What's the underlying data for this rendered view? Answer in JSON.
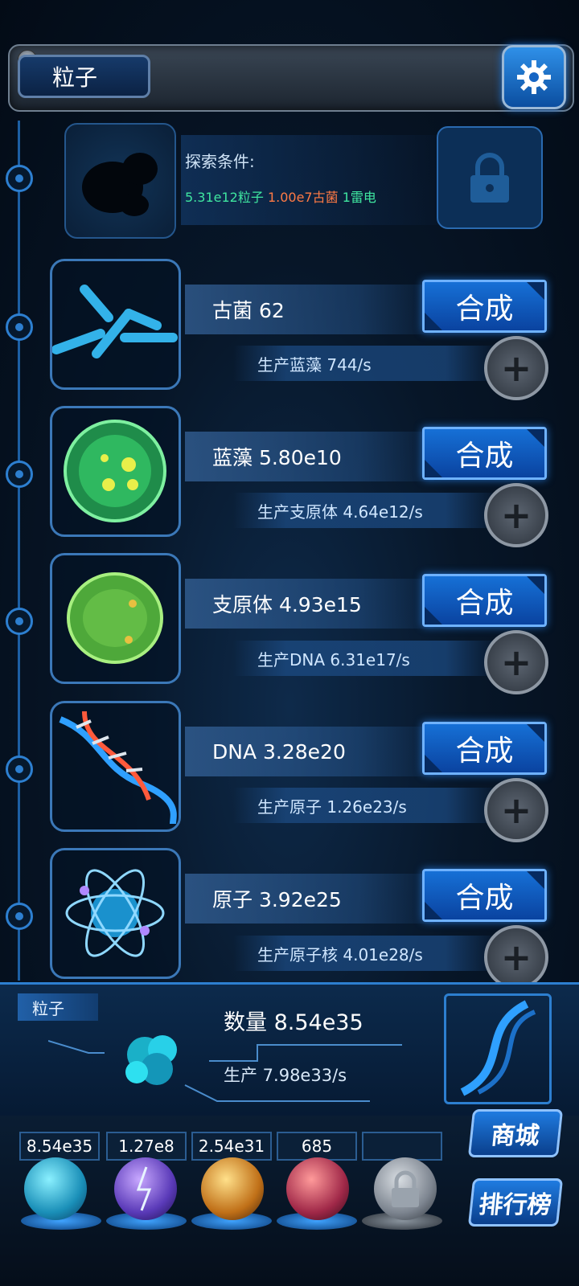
{
  "header": {
    "title": "粒子",
    "settings_icon": "gear-icon"
  },
  "explore": {
    "label": "探索条件:",
    "cond_particle": "5.31e12粒子",
    "cond_archaea": "1.00e7古菌",
    "cond_thunder": "1雷电",
    "colors": {
      "particle": "#3fe6a0",
      "archaea": "#ff7a45",
      "thunder": "#3fe6a0"
    }
  },
  "items": [
    {
      "name": "古菌 62",
      "produce": "生产蓝藻 744/s",
      "button": "合成"
    },
    {
      "name": "蓝藻 5.80e10",
      "produce": "生产支原体 4.64e12/s",
      "button": "合成"
    },
    {
      "name": "支原体 4.93e15",
      "produce": "生产DNA 6.31e17/s",
      "button": "合成"
    },
    {
      "name": "DNA 3.28e20",
      "produce": "生产原子 1.26e23/s",
      "button": "合成"
    },
    {
      "name": "原子 3.92e25",
      "produce": "生产原子核 4.01e28/s",
      "button": "合成"
    }
  ],
  "particle": {
    "tag": "粒子",
    "quantity": "数量 8.54e35",
    "rate": "生产 7.98e33/s"
  },
  "tabs": {
    "counters": [
      "8.54e35",
      "1.27e8",
      "2.54e31",
      "685",
      ""
    ],
    "shop": "商城",
    "ranking": "排行榜"
  }
}
